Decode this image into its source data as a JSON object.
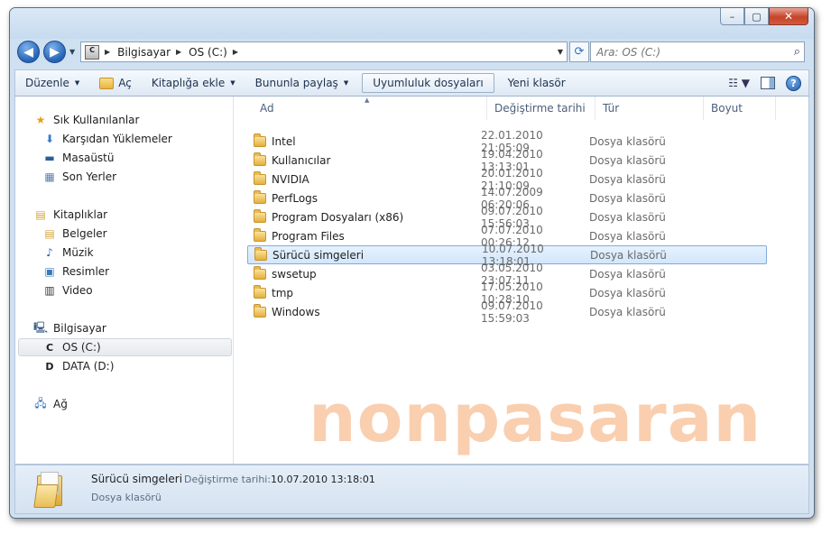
{
  "caption_buttons": [
    "–",
    "▢",
    "✕"
  ],
  "address": {
    "segments": [
      "Bilgisayar",
      "OS (C:)"
    ],
    "drive_icon_letter": "C"
  },
  "search": {
    "placeholder": "Ara: OS (C:)"
  },
  "toolbar": {
    "organize": "Düzenle",
    "open": "Aç",
    "add_to_library": "Kitaplığa ekle",
    "share_with": "Bununla paylaş",
    "compat_files": "Uyumluluk dosyaları",
    "new_folder": "Yeni klasör",
    "help": "?"
  },
  "nav": {
    "favorites": "Sık Kullanılanlar",
    "downloads": "Karşıdan Yüklemeler",
    "desktop": "Masaüstü",
    "recent": "Son Yerler",
    "libraries": "Kitaplıklar",
    "documents": "Belgeler",
    "music": "Müzik",
    "pictures": "Resimler",
    "video": "Video",
    "computer": "Bilgisayar",
    "drive_c": "OS (C:)",
    "drive_d": "DATA (D:)",
    "network": "Ağ"
  },
  "columns": {
    "name": "Ad",
    "date": "Değiştirme tarihi",
    "type": "Tür",
    "size": "Boyut"
  },
  "files": [
    {
      "name": "Intel",
      "date": "22.01.2010 21:05:09",
      "type": "Dosya klasörü"
    },
    {
      "name": "Kullanıcılar",
      "date": "19.04.2010 13:13:01",
      "type": "Dosya klasörü"
    },
    {
      "name": "NVIDIA",
      "date": "20.01.2010 21:10:09",
      "type": "Dosya klasörü"
    },
    {
      "name": "PerfLogs",
      "date": "14.07.2009 06:20:06",
      "type": "Dosya klasörü"
    },
    {
      "name": "Program Dosyaları (x86)",
      "date": "09.07.2010 15:56:03",
      "type": "Dosya klasörü"
    },
    {
      "name": "Program Files",
      "date": "07.07.2010 00:26:12",
      "type": "Dosya klasörü"
    },
    {
      "name": "Sürücü simgeleri",
      "date": "10.07.2010 13:18:01",
      "type": "Dosya klasörü",
      "selected": true
    },
    {
      "name": "swsetup",
      "date": "03.05.2010 23:07:11",
      "type": "Dosya klasörü"
    },
    {
      "name": "tmp",
      "date": "17.05.2010 10:28:10",
      "type": "Dosya klasörü"
    },
    {
      "name": "Windows",
      "date": "09.07.2010 15:59:03",
      "type": "Dosya klasörü"
    }
  ],
  "watermark": "nonpasaran",
  "details": {
    "name": "Sürücü simgeleri",
    "modified_label": "Değiştirme tarihi:",
    "modified_value": "10.07.2010 13:18:01",
    "type": "Dosya klasörü"
  }
}
